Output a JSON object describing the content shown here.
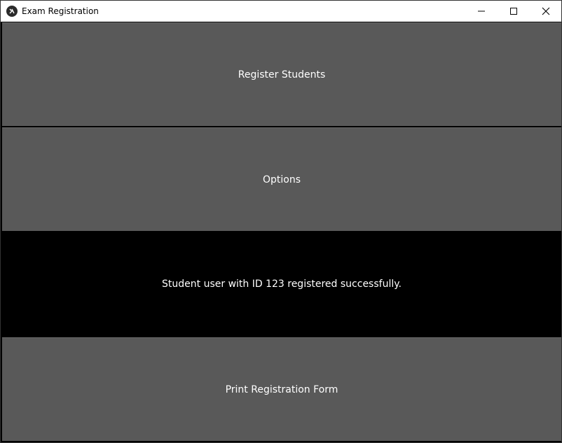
{
  "window": {
    "title": "Exam Registration",
    "app_icon": "kivy-logo-icon",
    "controls": [
      "minimize-icon",
      "maximize-icon",
      "close-icon"
    ]
  },
  "main": {
    "register_button": "Register Students",
    "options_button": "Options",
    "status_message": "Student user with ID 123 registered successfully.",
    "print_button": "Print Registration Form"
  },
  "colors": {
    "button_bg": "#595959",
    "background": "#000000",
    "text": "#ffffff",
    "titlebar": "#ffffff"
  }
}
